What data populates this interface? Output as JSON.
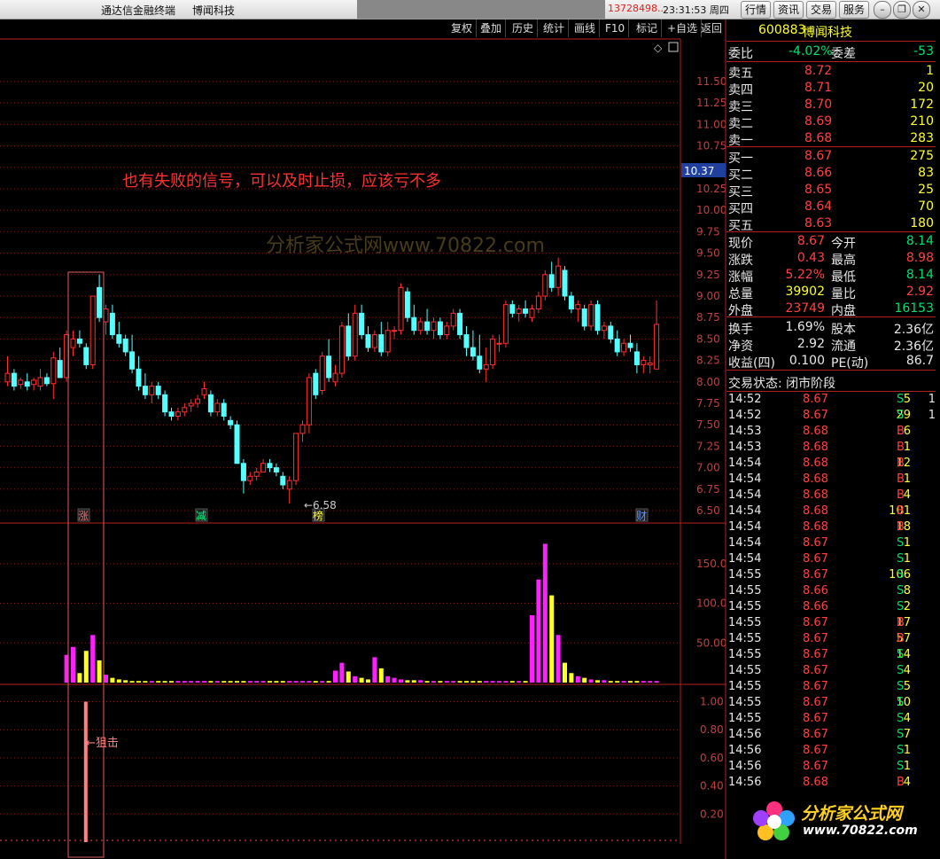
{
  "titlebar": {
    "app_title": "通达信金融终端",
    "stock_name": "博闻科技",
    "phone": "13728498...",
    "time": "23:31:53",
    "weekday": "周四",
    "buttons": [
      "行情",
      "资讯",
      "交易",
      "服务"
    ]
  },
  "toolbar": [
    "复权",
    "叠加",
    "历史",
    "统计",
    "画线",
    "F10",
    "标记",
    "+自选",
    "返回"
  ],
  "chart": {
    "annotation": "也有失败的信号，可以及时止损，应该亏不多",
    "watermark": "分析家公式网www.70822.com",
    "watermark_sub": "www.70822.com",
    "current_price_label": "10.37",
    "low_marker_label": "←6.58",
    "signal_label": "←狙击",
    "event_markers": [
      {
        "text": "涨",
        "color": "#ff6060"
      },
      {
        "text": "减",
        "color": "#00ff80"
      },
      {
        "text": "榜",
        "color": "#ffff30"
      },
      {
        "text": "财",
        "color": "#6090ff"
      }
    ],
    "price_axis": [
      11.5,
      11.25,
      11.0,
      10.75,
      10.5,
      10.25,
      10.0,
      9.75,
      9.5,
      9.25,
      9.0,
      8.75,
      8.5,
      8.25,
      8.0,
      7.75,
      7.5,
      7.25,
      7.0,
      6.75,
      6.5
    ],
    "volume_axis": [
      150.0,
      100.0,
      50.0
    ],
    "signal_axis": [
      1.0,
      0.8,
      0.6,
      0.4,
      0.2
    ]
  },
  "chart_data": [
    {
      "type": "candlestick",
      "title": "600883 博闻科技 日K线",
      "ylim": [
        6.5,
        11.6
      ],
      "candles": [
        {
          "o": 8.0,
          "h": 8.3,
          "l": 7.95,
          "c": 8.1
        },
        {
          "o": 8.1,
          "h": 8.15,
          "l": 7.9,
          "c": 7.95
        },
        {
          "o": 7.97,
          "h": 8.05,
          "l": 7.92,
          "c": 8.02
        },
        {
          "o": 8.0,
          "h": 8.1,
          "l": 7.9,
          "c": 7.95
        },
        {
          "o": 7.97,
          "h": 8.05,
          "l": 7.9,
          "c": 8.02
        },
        {
          "o": 7.95,
          "h": 8.15,
          "l": 7.9,
          "c": 8.05
        },
        {
          "o": 8.05,
          "h": 8.1,
          "l": 7.95,
          "c": 7.98
        },
        {
          "o": 7.98,
          "h": 8.35,
          "l": 7.8,
          "c": 8.28
        },
        {
          "o": 8.25,
          "h": 8.4,
          "l": 8.05,
          "c": 8.05
        },
        {
          "o": 8.05,
          "h": 8.6,
          "l": 8.0,
          "c": 8.55
        },
        {
          "o": 8.4,
          "h": 8.6,
          "l": 8.3,
          "c": 8.5
        },
        {
          "o": 8.5,
          "h": 8.6,
          "l": 8.4,
          "c": 8.45
        },
        {
          "o": 8.4,
          "h": 8.45,
          "l": 8.15,
          "c": 8.2
        },
        {
          "o": 8.2,
          "h": 9.0,
          "l": 8.15,
          "c": 9.0
        },
        {
          "o": 9.1,
          "h": 9.25,
          "l": 8.7,
          "c": 8.75
        },
        {
          "o": 8.7,
          "h": 8.9,
          "l": 8.55,
          "c": 8.85
        },
        {
          "o": 8.8,
          "h": 8.9,
          "l": 8.5,
          "c": 8.55
        },
        {
          "o": 8.55,
          "h": 8.7,
          "l": 8.4,
          "c": 8.45
        },
        {
          "o": 8.5,
          "h": 8.55,
          "l": 8.3,
          "c": 8.35
        },
        {
          "o": 8.35,
          "h": 8.55,
          "l": 8.1,
          "c": 8.15
        },
        {
          "o": 8.15,
          "h": 8.3,
          "l": 7.9,
          "c": 7.95
        },
        {
          "o": 7.95,
          "h": 8.1,
          "l": 7.8,
          "c": 7.85
        },
        {
          "o": 7.85,
          "h": 8.0,
          "l": 7.75,
          "c": 7.95
        },
        {
          "o": 7.95,
          "h": 8.0,
          "l": 7.8,
          "c": 7.85
        },
        {
          "o": 7.85,
          "h": 7.9,
          "l": 7.6,
          "c": 7.65
        },
        {
          "o": 7.65,
          "h": 7.7,
          "l": 7.55,
          "c": 7.6
        },
        {
          "o": 7.6,
          "h": 7.7,
          "l": 7.55,
          "c": 7.65
        },
        {
          "o": 7.65,
          "h": 7.75,
          "l": 7.6,
          "c": 7.7
        },
        {
          "o": 7.72,
          "h": 7.8,
          "l": 7.65,
          "c": 7.75
        },
        {
          "o": 7.75,
          "h": 7.85,
          "l": 7.7,
          "c": 7.8
        },
        {
          "o": 7.85,
          "h": 8.0,
          "l": 7.8,
          "c": 7.92
        },
        {
          "o": 7.85,
          "h": 7.9,
          "l": 7.6,
          "c": 7.65
        },
        {
          "o": 7.65,
          "h": 7.8,
          "l": 7.6,
          "c": 7.75
        },
        {
          "o": 7.75,
          "h": 7.8,
          "l": 7.55,
          "c": 7.6
        },
        {
          "o": 7.55,
          "h": 7.6,
          "l": 7.45,
          "c": 7.5
        },
        {
          "o": 7.5,
          "h": 7.55,
          "l": 7.05,
          "c": 7.05
        },
        {
          "o": 7.05,
          "h": 7.1,
          "l": 6.7,
          "c": 6.85
        },
        {
          "o": 6.85,
          "h": 6.95,
          "l": 6.8,
          "c": 6.9
        },
        {
          "o": 6.9,
          "h": 7.0,
          "l": 6.85,
          "c": 6.95
        },
        {
          "o": 6.95,
          "h": 7.1,
          "l": 6.95,
          "c": 7.05
        },
        {
          "o": 7.05,
          "h": 7.1,
          "l": 6.95,
          "c": 7.0
        },
        {
          "o": 7.0,
          "h": 7.05,
          "l": 6.9,
          "c": 6.95
        },
        {
          "o": 6.9,
          "h": 6.95,
          "l": 6.75,
          "c": 6.8
        },
        {
          "o": 6.75,
          "h": 6.9,
          "l": 6.58,
          "c": 6.85
        },
        {
          "o": 6.85,
          "h": 7.4,
          "l": 6.8,
          "c": 7.4
        },
        {
          "o": 7.4,
          "h": 7.55,
          "l": 7.3,
          "c": 7.5
        },
        {
          "o": 7.5,
          "h": 8.1,
          "l": 7.4,
          "c": 8.05
        },
        {
          "o": 8.1,
          "h": 8.15,
          "l": 7.8,
          "c": 7.85
        },
        {
          "o": 7.9,
          "h": 8.35,
          "l": 7.85,
          "c": 8.3
        },
        {
          "o": 8.3,
          "h": 8.5,
          "l": 8.0,
          "c": 8.05
        },
        {
          "o": 8.0,
          "h": 8.2,
          "l": 7.95,
          "c": 8.1
        },
        {
          "o": 8.1,
          "h": 8.7,
          "l": 8.05,
          "c": 8.65
        },
        {
          "o": 8.65,
          "h": 8.8,
          "l": 8.25,
          "c": 8.3
        },
        {
          "o": 8.3,
          "h": 8.9,
          "l": 8.25,
          "c": 8.8
        },
        {
          "o": 8.8,
          "h": 8.9,
          "l": 8.5,
          "c": 8.55
        },
        {
          "o": 8.55,
          "h": 8.65,
          "l": 8.35,
          "c": 8.4
        },
        {
          "o": 8.4,
          "h": 8.6,
          "l": 8.35,
          "c": 8.55
        },
        {
          "o": 8.55,
          "h": 8.7,
          "l": 8.3,
          "c": 8.35
        },
        {
          "o": 8.35,
          "h": 8.7,
          "l": 8.3,
          "c": 8.6
        },
        {
          "o": 8.6,
          "h": 8.65,
          "l": 8.5,
          "c": 8.6
        },
        {
          "o": 8.6,
          "h": 9.15,
          "l": 8.55,
          "c": 9.1
        },
        {
          "o": 9.05,
          "h": 9.1,
          "l": 8.7,
          "c": 8.75
        },
        {
          "o": 8.75,
          "h": 8.9,
          "l": 8.55,
          "c": 8.6
        },
        {
          "o": 8.6,
          "h": 8.75,
          "l": 8.55,
          "c": 8.7
        },
        {
          "o": 8.7,
          "h": 8.85,
          "l": 8.55,
          "c": 8.6
        },
        {
          "o": 8.6,
          "h": 8.75,
          "l": 8.5,
          "c": 8.7
        },
        {
          "o": 8.7,
          "h": 8.75,
          "l": 8.5,
          "c": 8.55
        },
        {
          "o": 8.55,
          "h": 8.7,
          "l": 8.5,
          "c": 8.65
        },
        {
          "o": 8.65,
          "h": 8.85,
          "l": 8.6,
          "c": 8.8
        },
        {
          "o": 8.8,
          "h": 8.85,
          "l": 8.5,
          "c": 8.55
        },
        {
          "o": 8.55,
          "h": 8.65,
          "l": 8.3,
          "c": 8.4
        },
        {
          "o": 8.4,
          "h": 8.6,
          "l": 8.25,
          "c": 8.3
        },
        {
          "o": 8.3,
          "h": 8.55,
          "l": 8.1,
          "c": 8.15
        },
        {
          "o": 8.15,
          "h": 8.4,
          "l": 8.0,
          "c": 8.2
        },
        {
          "o": 8.2,
          "h": 8.55,
          "l": 8.15,
          "c": 8.5
        },
        {
          "o": 8.45,
          "h": 8.55,
          "l": 8.35,
          "c": 8.45
        },
        {
          "o": 8.45,
          "h": 8.95,
          "l": 8.4,
          "c": 8.9
        },
        {
          "o": 8.9,
          "h": 8.95,
          "l": 8.75,
          "c": 8.8
        },
        {
          "o": 8.8,
          "h": 8.9,
          "l": 8.7,
          "c": 8.85
        },
        {
          "o": 8.85,
          "h": 8.95,
          "l": 8.75,
          "c": 8.8
        },
        {
          "o": 8.75,
          "h": 8.9,
          "l": 8.7,
          "c": 8.85
        },
        {
          "o": 8.85,
          "h": 9.05,
          "l": 8.8,
          "c": 9.0
        },
        {
          "o": 9.0,
          "h": 9.3,
          "l": 8.95,
          "c": 9.25
        },
        {
          "o": 9.25,
          "h": 9.4,
          "l": 9.05,
          "c": 9.1
        },
        {
          "o": 9.1,
          "h": 9.45,
          "l": 9.0,
          "c": 9.35
        },
        {
          "o": 9.3,
          "h": 9.35,
          "l": 8.95,
          "c": 9.0
        },
        {
          "o": 9.0,
          "h": 9.05,
          "l": 8.8,
          "c": 8.85
        },
        {
          "o": 8.85,
          "h": 8.95,
          "l": 8.7,
          "c": 8.9
        },
        {
          "o": 8.85,
          "h": 8.9,
          "l": 8.6,
          "c": 8.65
        },
        {
          "o": 8.65,
          "h": 8.95,
          "l": 8.6,
          "c": 8.9
        },
        {
          "o": 8.9,
          "h": 8.95,
          "l": 8.55,
          "c": 8.6
        },
        {
          "o": 8.6,
          "h": 8.7,
          "l": 8.5,
          "c": 8.65
        },
        {
          "o": 8.65,
          "h": 8.7,
          "l": 8.45,
          "c": 8.5
        },
        {
          "o": 8.5,
          "h": 8.6,
          "l": 8.3,
          "c": 8.35
        },
        {
          "o": 8.35,
          "h": 8.5,
          "l": 8.3,
          "c": 8.45
        },
        {
          "o": 8.45,
          "h": 8.55,
          "l": 8.35,
          "c": 8.4
        },
        {
          "o": 8.35,
          "h": 8.45,
          "l": 8.1,
          "c": 8.2
        },
        {
          "o": 8.2,
          "h": 8.3,
          "l": 8.1,
          "c": 8.25
        },
        {
          "o": 8.2,
          "h": 8.3,
          "l": 8.1,
          "c": 8.22
        },
        {
          "o": 8.15,
          "h": 8.95,
          "l": 8.15,
          "c": 8.67
        }
      ],
      "volumes": [
        0,
        0,
        0,
        0,
        0,
        0,
        0,
        0,
        0,
        35,
        45,
        12,
        40,
        60,
        28,
        10,
        6,
        4,
        3,
        2,
        2,
        2,
        2,
        2,
        2,
        2,
        2,
        2,
        2,
        2,
        2,
        2,
        2,
        2,
        2,
        2,
        2,
        2,
        2,
        2,
        2,
        2,
        2,
        2,
        2,
        2,
        2,
        2,
        2,
        2,
        15,
        25,
        14,
        8,
        6,
        4,
        32,
        18,
        8,
        6,
        4,
        3,
        3,
        3,
        2,
        2,
        2,
        2,
        2,
        2,
        2,
        2,
        2,
        2,
        2,
        2,
        2,
        2,
        2,
        2,
        85,
        130,
        175,
        110,
        60,
        25,
        12,
        8,
        6,
        4,
        3,
        3,
        2,
        2,
        2,
        2,
        2,
        2,
        2,
        2
      ],
      "signal": [
        0,
        0,
        0,
        0,
        0,
        0,
        0,
        0,
        0,
        0,
        0,
        0,
        1,
        0,
        0
      ]
    }
  ],
  "quote": {
    "code": "600883",
    "name": "博闻科技",
    "weibi_label": "委比",
    "weibi": "-4.02%",
    "weicha_label": "委差",
    "weicha": "-53",
    "asks": [
      {
        "label": "卖五",
        "price": "8.72",
        "vol": "1"
      },
      {
        "label": "卖四",
        "price": "8.71",
        "vol": "20"
      },
      {
        "label": "卖三",
        "price": "8.70",
        "vol": "172"
      },
      {
        "label": "卖二",
        "price": "8.69",
        "vol": "210"
      },
      {
        "label": "卖一",
        "price": "8.68",
        "vol": "283"
      }
    ],
    "bids": [
      {
        "label": "买一",
        "price": "8.67",
        "vol": "275"
      },
      {
        "label": "买二",
        "price": "8.66",
        "vol": "83"
      },
      {
        "label": "买三",
        "price": "8.65",
        "vol": "25"
      },
      {
        "label": "买四",
        "price": "8.64",
        "vol": "70"
      },
      {
        "label": "买五",
        "price": "8.63",
        "vol": "180"
      }
    ],
    "stats": [
      {
        "l1": "现价",
        "v1": "8.67",
        "c1": "red",
        "l2": "今开",
        "v2": "8.14",
        "c2": "green"
      },
      {
        "l1": "涨跌",
        "v1": "0.43",
        "c1": "red",
        "l2": "最高",
        "v2": "8.98",
        "c2": "red"
      },
      {
        "l1": "涨幅",
        "v1": "5.22%",
        "c1": "red",
        "l2": "最低",
        "v2": "8.14",
        "c2": "green"
      },
      {
        "l1": "总量",
        "v1": "39902",
        "c1": "yel",
        "l2": "量比",
        "v2": "2.92",
        "c2": "red"
      },
      {
        "l1": "外盘",
        "v1": "23749",
        "c1": "red",
        "l2": "内盘",
        "v2": "16153",
        "c2": "green"
      }
    ],
    "fundamentals": [
      {
        "l1": "换手",
        "v1": "1.69%",
        "l2": "股本",
        "v2": "2.36亿"
      },
      {
        "l1": "净资",
        "v1": "2.92",
        "l2": "流通",
        "v2": "2.36亿"
      },
      {
        "l1": "收益(四)",
        "v1": "0.100",
        "l2": "PE(动)",
        "v2": "86.7"
      }
    ],
    "status_label": "交易状态: 闭市阶段",
    "ticks": [
      {
        "t": "14:52",
        "p": "8.67",
        "v": "5",
        "s": "S"
      },
      {
        "t": "14:52",
        "p": "8.67",
        "v": "29",
        "s": "S"
      },
      {
        "t": "14:53",
        "p": "8.68",
        "v": "6",
        "s": "B"
      },
      {
        "t": "14:53",
        "p": "8.68",
        "v": "1",
        "s": "B"
      },
      {
        "t": "14:54",
        "p": "8.68",
        "v": "12",
        "s": "B"
      },
      {
        "t": "14:54",
        "p": "8.68",
        "v": "1",
        "s": "B"
      },
      {
        "t": "14:54",
        "p": "8.68",
        "v": "4",
        "s": "B"
      },
      {
        "t": "14:54",
        "p": "8.68",
        "v": "101",
        "s": "B"
      },
      {
        "t": "14:54",
        "p": "8.68",
        "v": "18",
        "s": "B"
      },
      {
        "t": "14:54",
        "p": "8.67",
        "v": "1",
        "s": "S"
      },
      {
        "t": "14:54",
        "p": "8.67",
        "v": "1",
        "s": "S"
      },
      {
        "t": "14:55",
        "p": "8.67",
        "v": "106",
        "s": "S"
      },
      {
        "t": "14:55",
        "p": "8.66",
        "v": "8",
        "s": "S"
      },
      {
        "t": "14:55",
        "p": "8.66",
        "v": "2",
        "s": "S"
      },
      {
        "t": "14:55",
        "p": "8.67",
        "v": "17",
        "s": "B"
      },
      {
        "t": "14:55",
        "p": "8.67",
        "v": "57",
        "s": "B"
      },
      {
        "t": "14:55",
        "p": "8.67",
        "v": "14",
        "s": "S"
      },
      {
        "t": "14:55",
        "p": "8.67",
        "v": "4",
        "s": "S"
      },
      {
        "t": "14:55",
        "p": "8.67",
        "v": "5",
        "s": "S"
      },
      {
        "t": "14:55",
        "p": "8.67",
        "v": "10",
        "s": "S"
      },
      {
        "t": "14:55",
        "p": "8.67",
        "v": "4",
        "s": "S"
      },
      {
        "t": "14:56",
        "p": "8.67",
        "v": "7",
        "s": "S"
      },
      {
        "t": "14:56",
        "p": "8.67",
        "v": "1",
        "s": "S"
      },
      {
        "t": "14:56",
        "p": "8.67",
        "v": "1",
        "s": "S"
      },
      {
        "t": "14:56",
        "p": "8.68",
        "v": "4",
        "s": "B"
      }
    ],
    "tick_trailing": [
      "1",
      "1",
      "",
      "",
      "",
      "",
      "",
      "",
      "",
      "",
      "",
      "",
      "",
      "",
      "",
      "",
      "",
      "",
      "",
      "",
      "",
      "",
      "",
      "",
      ""
    ],
    "logo_text": "分析家公式网",
    "logo_sub": "www.70822.com"
  },
  "colors": {
    "up": "#ff3030",
    "down": "#54ffff",
    "vol_up": "#ff20ff",
    "vol_down": "#ffff20",
    "signal": "#ff8080",
    "frame": "#b02020"
  }
}
